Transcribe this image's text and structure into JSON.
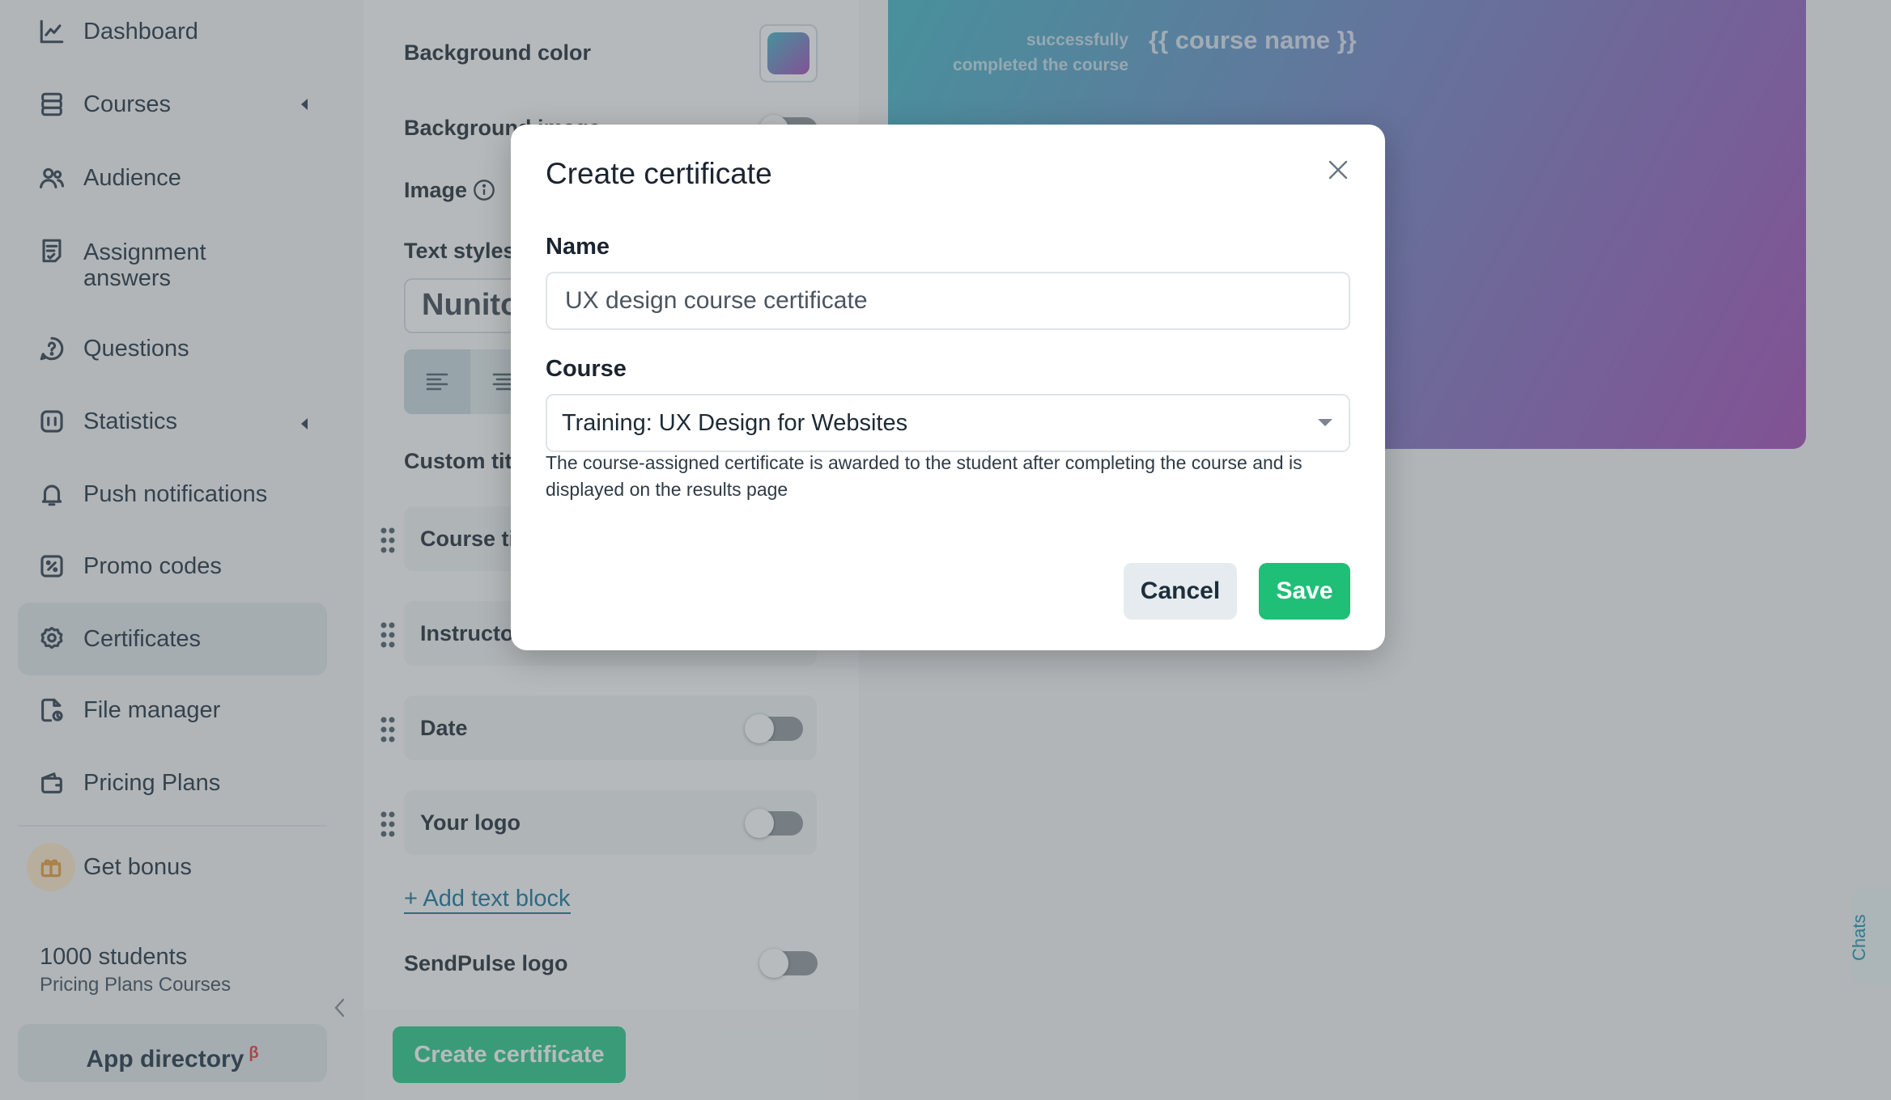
{
  "sidebar": {
    "items": [
      {
        "label": "Dashboard",
        "icon": "chart-line-icon"
      },
      {
        "label": "Courses",
        "icon": "layers-icon"
      },
      {
        "label": "Audience",
        "icon": "users-icon"
      },
      {
        "label_line1": "Assignment",
        "label_line2": "answers",
        "icon": "assignment-icon"
      },
      {
        "label": "Questions",
        "icon": "question-icon"
      },
      {
        "label": "Statistics",
        "icon": "stats-icon"
      },
      {
        "label": "Push notifications",
        "icon": "bell-icon"
      },
      {
        "label": "Promo codes",
        "icon": "promo-icon"
      },
      {
        "label": "Certificates",
        "icon": "certificate-icon"
      },
      {
        "label": "File manager",
        "icon": "file-manager-icon"
      },
      {
        "label": "Pricing Plans",
        "icon": "wallet-icon"
      }
    ],
    "active_item": "Certificates",
    "bonus_label": "Get bonus",
    "plan_count": "1000 students",
    "plan_name": "Pricing Plans Courses",
    "app_directory_label": "App directory",
    "beta_mark": "β"
  },
  "editor": {
    "background_color_label": "Background color",
    "background_image_label": "Background image",
    "image_label": "Image",
    "text_styles_label": "Text styles",
    "font_value": "Nunito",
    "custom_titles_label": "Custom titles",
    "blocks": [
      "Course title",
      "Instructor",
      "Date",
      "Your logo"
    ],
    "add_block_label": "+ Add text block",
    "sendpulse_logo_label": "SendPulse logo",
    "create_button_label": "Create certificate"
  },
  "preview": {
    "completed_line1": "successfully",
    "completed_line2": "completed the course",
    "course_placeholder": "{{ course name }}"
  },
  "chats_label": "Chats",
  "modal": {
    "title": "Create certificate",
    "name_label": "Name",
    "name_value": "UX design course certificate",
    "course_label": "Course",
    "course_value": "Training: UX Design for Websites",
    "hint": "The course-assigned certificate is awarded to the student after completing the course and is displayed on the results page",
    "cancel_label": "Cancel",
    "save_label": "Save"
  },
  "colors": {
    "accent_green": "#1fbf78",
    "link_blue": "#14749a",
    "preview_gradient_start": "#3fb6c6",
    "preview_gradient_end": "#a24bb8"
  }
}
